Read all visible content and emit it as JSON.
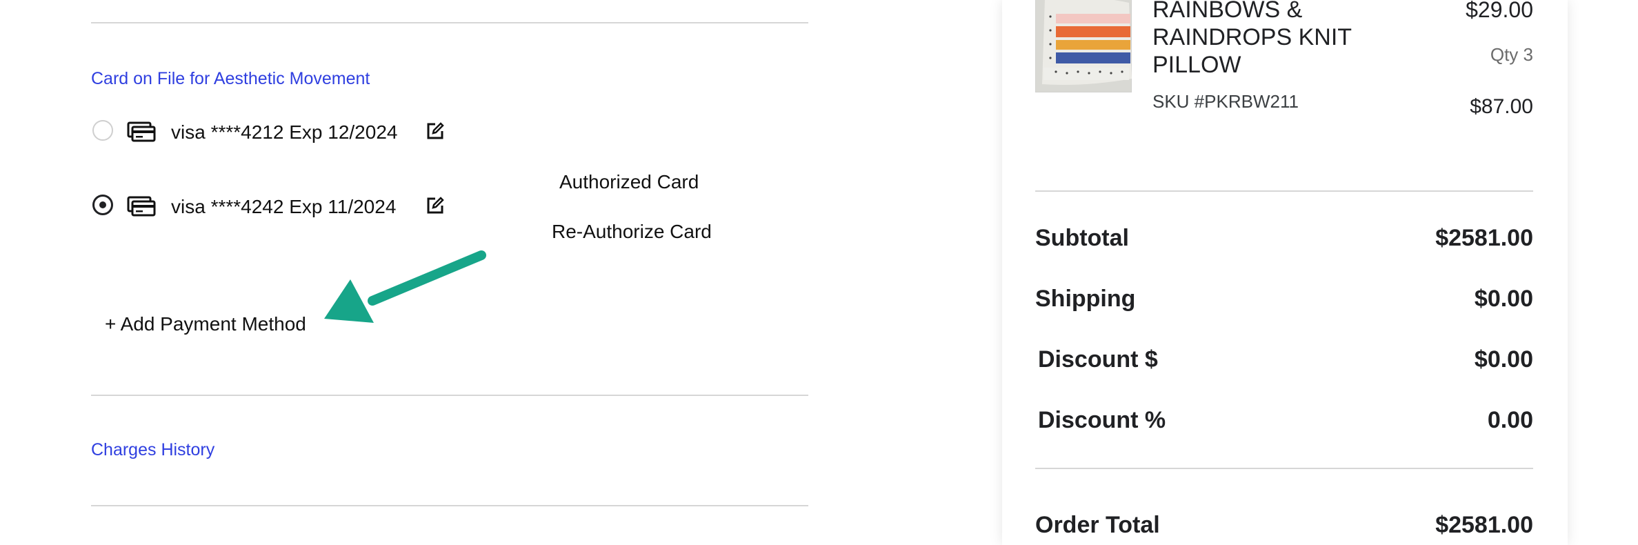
{
  "payment": {
    "card_on_file_label": "Card on File for Aesthetic Movement",
    "cards": [
      {
        "text": "visa ****4212 Exp 12/2024",
        "selected": false
      },
      {
        "text": "visa ****4242 Exp 11/2024",
        "selected": true
      }
    ],
    "authorized_card_label": "Authorized Card",
    "reauthorize_label": "Re-Authorize Card",
    "add_payment_label": "+ Add Payment Method",
    "charges_history_label": "Charges History"
  },
  "order_item": {
    "name_line1": "RAINBOWS &",
    "name_line2": "RAINDROPS KNIT",
    "name_line3": "PILLOW",
    "sku": "SKU #PKRBW211",
    "unit_price": "$29.00",
    "qty": "Qty 3",
    "line_total": "$87.00"
  },
  "summary": {
    "subtotal_label": "Subtotal",
    "subtotal_value": "$2581.00",
    "shipping_label": "Shipping",
    "shipping_value": "$0.00",
    "discount_amt_label": "Discount $",
    "discount_amt_value": "$0.00",
    "discount_pct_label": "Discount %",
    "discount_pct_value": "0.00",
    "order_total_label": "Order Total",
    "order_total_value": "$2581.00"
  },
  "colors": {
    "link": "#2f3fe0",
    "annotation_arrow": "#17a589"
  },
  "icons": {
    "card": "credit-card-icon",
    "edit": "edit-icon"
  }
}
